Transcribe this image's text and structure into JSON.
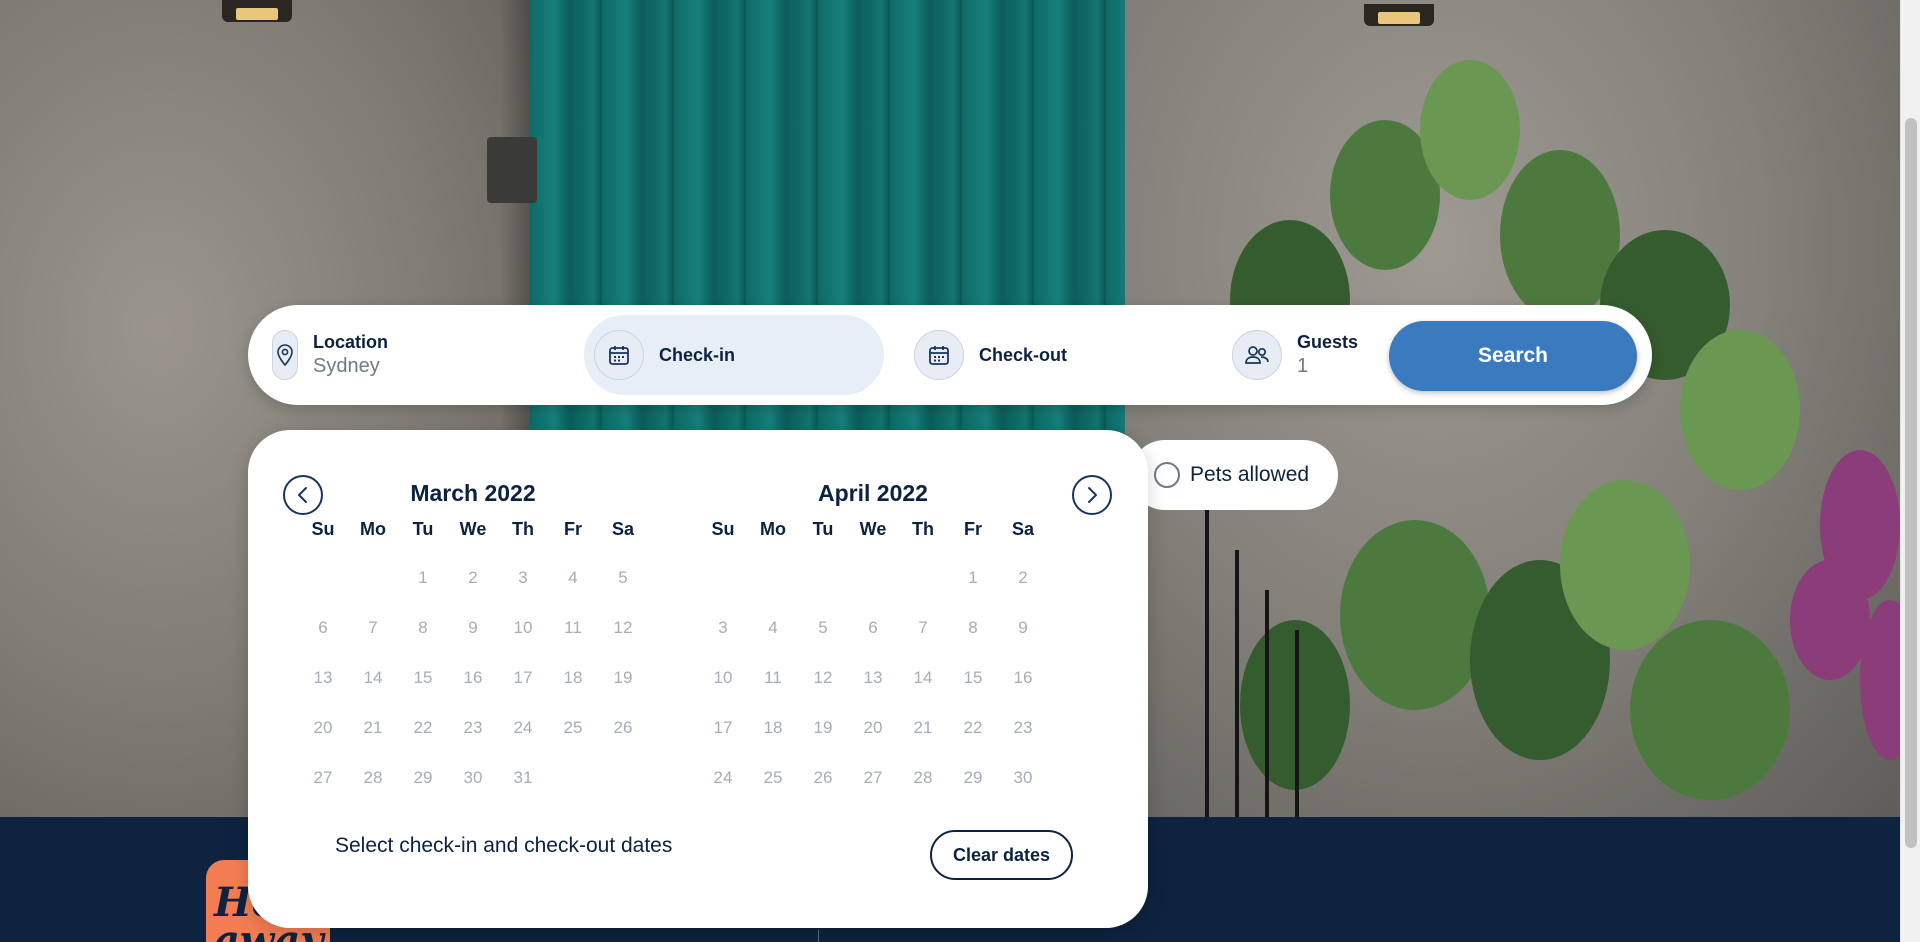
{
  "search": {
    "location_label": "Location",
    "location_value": "Sydney",
    "checkin_label": "Check-in",
    "checkout_label": "Check-out",
    "guests_label": "Guests",
    "guests_value": "1",
    "search_label": "Search"
  },
  "filters": {
    "pets_label": "Pets allowed",
    "pets_checked": false
  },
  "calendar": {
    "weekdays": [
      "Su",
      "Mo",
      "Tu",
      "We",
      "Th",
      "Fr",
      "Sa"
    ],
    "months": [
      {
        "title": "March 2022",
        "first_weekday": 2,
        "days": [
          "1",
          "2",
          "3",
          "4",
          "5",
          "6",
          "7",
          "8",
          "9",
          "10",
          "11",
          "12",
          "13",
          "14",
          "15",
          "16",
          "17",
          "18",
          "19",
          "20",
          "21",
          "22",
          "23",
          "24",
          "25",
          "26",
          "27",
          "28",
          "29",
          "30",
          "31"
        ]
      },
      {
        "title": "April 2022",
        "first_weekday": 5,
        "days": [
          "1",
          "2",
          "3",
          "4",
          "5",
          "6",
          "7",
          "8",
          "9",
          "10",
          "11",
          "12",
          "13",
          "14",
          "15",
          "16",
          "17",
          "18",
          "19",
          "20",
          "21",
          "22",
          "23",
          "24",
          "25",
          "26",
          "27",
          "28",
          "29",
          "30"
        ]
      }
    ],
    "hint": "Select check-in and check-out dates",
    "clear_label": "Clear dates"
  },
  "icons": {
    "location": "map-pin-icon",
    "checkin": "calendar-icon",
    "checkout": "calendar-icon",
    "guests": "users-icon",
    "prev": "chevron-left-icon",
    "next": "chevron-right-icon"
  },
  "colors": {
    "primary": "#3a7bbf",
    "navy": "#0b2240",
    "footer": "#0d2340",
    "logo": "#f47c52",
    "disabled_day": "#a5adb8"
  }
}
